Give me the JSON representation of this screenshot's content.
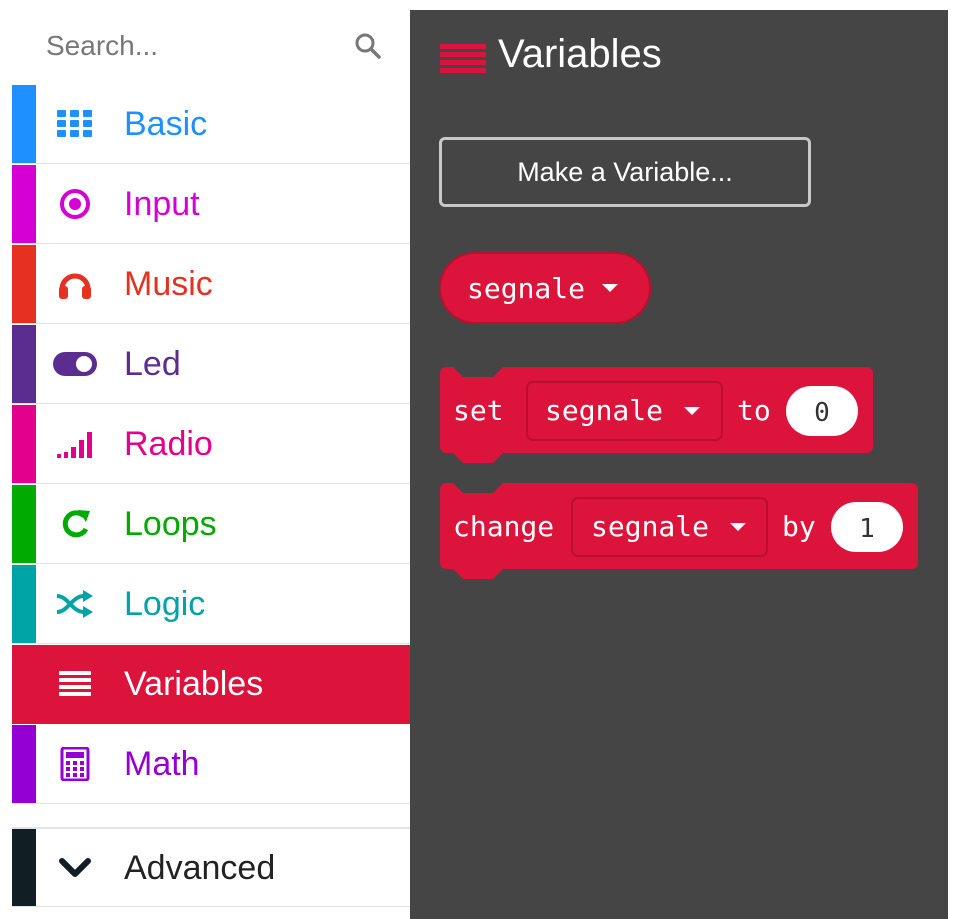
{
  "search": {
    "placeholder": "Search..."
  },
  "categories": [
    {
      "label": "Basic",
      "color": "#1e90ff",
      "icon": "grid-icon"
    },
    {
      "label": "Input",
      "color": "#d400d4",
      "icon": "target-icon"
    },
    {
      "label": "Music",
      "color": "#e63022",
      "icon": "headphones-icon"
    },
    {
      "label": "Led",
      "color": "#5c2d91",
      "icon": "toggle-icon"
    },
    {
      "label": "Radio",
      "color": "#e3008c",
      "icon": "signal-bars-icon"
    },
    {
      "label": "Loops",
      "color": "#00aa00",
      "icon": "loop-arrow-icon"
    },
    {
      "label": "Logic",
      "color": "#00a4a6",
      "icon": "shuffle-icon"
    },
    {
      "label": "Variables",
      "color": "#dc143c",
      "icon": "list-lines-icon"
    },
    {
      "label": "Math",
      "color": "#9400d3",
      "icon": "calculator-icon"
    }
  ],
  "advanced": {
    "label": "Advanced",
    "color": "#111e24",
    "icon": "chevron-down-icon"
  },
  "flyout": {
    "title": "Variables",
    "accent": "#dc143c",
    "background": "#454545",
    "make_variable_label": "Make a Variable...",
    "variable_block": {
      "name": "segnale"
    },
    "set_block": {
      "keyword": "set",
      "variable": "segnale",
      "to": "to",
      "value": "0"
    },
    "change_block": {
      "keyword": "change",
      "variable": "segnale",
      "by": "by",
      "value": "1"
    }
  }
}
